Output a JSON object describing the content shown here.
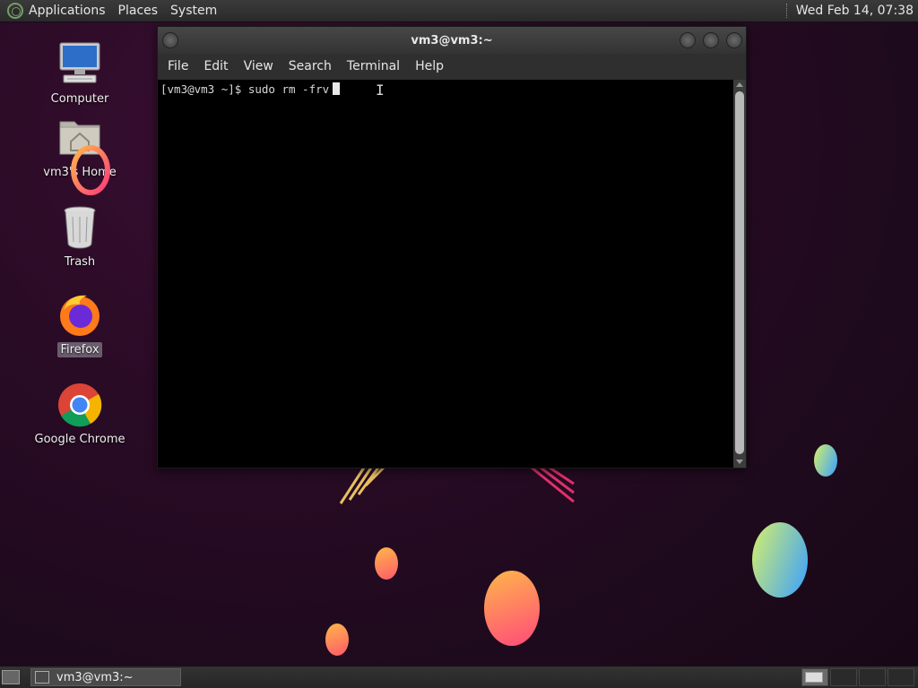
{
  "top_panel": {
    "menus": [
      "Applications",
      "Places",
      "System"
    ],
    "clock": "Wed Feb 14, 07:38"
  },
  "desktop": {
    "icons": [
      {
        "label": "Computer",
        "icon": "computer-icon"
      },
      {
        "label": "vm3's Home",
        "icon": "home-folder-icon"
      },
      {
        "label": "Trash",
        "icon": "trash-icon"
      },
      {
        "label": "Firefox",
        "icon": "firefox-icon"
      },
      {
        "label": "Google Chrome",
        "icon": "chrome-icon"
      }
    ]
  },
  "terminal": {
    "title": "vm3@vm3:~",
    "menu": [
      "File",
      "Edit",
      "View",
      "Search",
      "Terminal",
      "Help"
    ],
    "prompt": "[vm3@vm3 ~]$ ",
    "command": "sudo rm -frv"
  },
  "bottom_panel": {
    "task_label": "vm3@vm3:~"
  }
}
